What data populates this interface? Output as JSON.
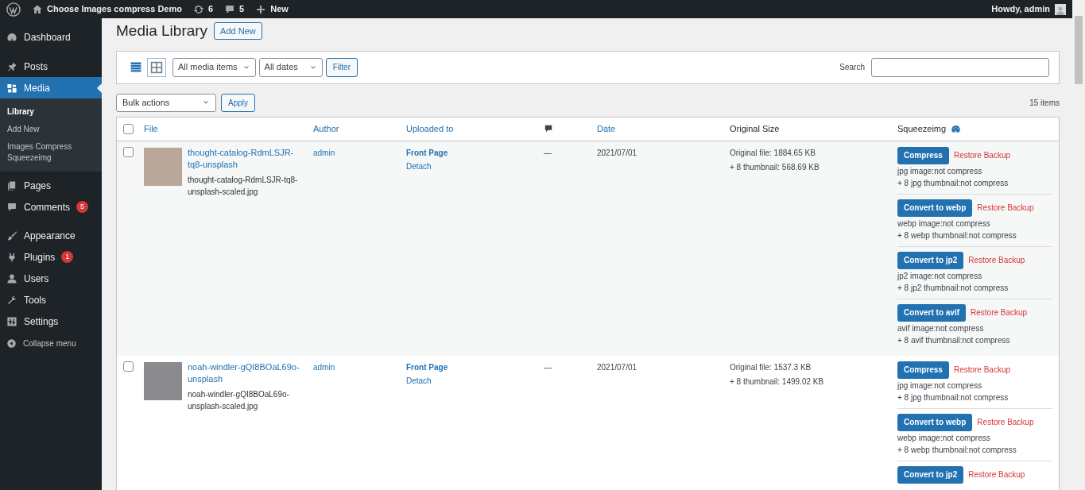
{
  "admin_bar": {
    "site_name": "Choose Images compress Demo",
    "updates": "6",
    "comments": "5",
    "new": "New",
    "greeting": "Howdy, admin"
  },
  "sidebar": {
    "items": [
      {
        "label": "Dashboard",
        "selected": false
      },
      {
        "label": "Posts",
        "selected": false
      },
      {
        "label": "Media",
        "selected": true,
        "children": [
          {
            "label": "Library",
            "selected": true
          },
          {
            "label": "Add New",
            "selected": false
          },
          {
            "label": "Images Compress Squeezeimg",
            "selected": false
          }
        ]
      },
      {
        "label": "Pages",
        "selected": false
      },
      {
        "label": "Comments",
        "selected": false,
        "badge": "5"
      },
      {
        "label": "Appearance",
        "selected": false
      },
      {
        "label": "Plugins",
        "selected": false,
        "badge": "1"
      },
      {
        "label": "Users",
        "selected": false
      },
      {
        "label": "Tools",
        "selected": false
      },
      {
        "label": "Settings",
        "selected": false
      }
    ],
    "collapse": "Collapse menu"
  },
  "page": {
    "title": "Media Library",
    "add_new": "Add New"
  },
  "filters": {
    "views": [
      {
        "kind": "list",
        "selected": true
      },
      {
        "kind": "grid",
        "selected": false
      }
    ],
    "media_type": "All media items",
    "dates": "All dates",
    "filter_button": "Filter",
    "search_label": "Search"
  },
  "bulk": {
    "action": "Bulk actions",
    "apply": "Apply",
    "count": "15 items"
  },
  "table": {
    "select_all": {
      "checked": false
    },
    "columns": [
      {
        "label": "File",
        "sortable": true
      },
      {
        "label": "Author",
        "sortable": true
      },
      {
        "label": "Uploaded to",
        "sortable": true
      },
      {
        "kind": "comments",
        "sortable": false
      },
      {
        "label": "Date",
        "sortable": true
      },
      {
        "label": "Original Size",
        "sortable": false
      },
      {
        "label": "Squeezeimg",
        "sortable": false,
        "kind": "squeeze"
      }
    ],
    "rows": [
      {
        "checked": false,
        "title": "thought-catalog-RdmLSJR-tq8-unsplash",
        "filename": "thought-catalog-RdmLSJR-tq8-unsplash-scaled.jpg",
        "author": "admin",
        "uploaded_to": "Front Page",
        "detach": "Detach",
        "comments": "—",
        "date": "2021/07/01",
        "size": [
          "Original file: 1884.65 KB",
          "+ 8 thumbnail: 568.69 KB"
        ],
        "actions": [
          {
            "button": "Compress",
            "restore": "Restore Backup",
            "lines": [
              "jpg image:not compress",
              "+ 8 jpg thumbnail:not compress"
            ]
          },
          {
            "button": "Convert to webp",
            "restore": "Restore Backup",
            "lines": [
              "webp image:not compress",
              "+ 8 webp thumbnail:not compress"
            ]
          },
          {
            "button": "Convert to jp2",
            "restore": "Restore Backup",
            "lines": [
              "jp2 image:not compress",
              "+ 8 jp2 thumbnail:not compress"
            ]
          },
          {
            "button": "Convert to avif",
            "restore": "Restore Backup",
            "lines": [
              "avif image:not compress",
              "+ 8 avif thumbnail:not compress"
            ]
          }
        ]
      },
      {
        "checked": false,
        "title": "noah-windler-gQI8BOaL69o-unsplash",
        "filename": "noah-windler-gQI8BOaL69o-unsplash-scaled.jpg",
        "author": "admin",
        "uploaded_to": "Front Page",
        "detach": "Detach",
        "comments": "—",
        "date": "2021/07/01",
        "size": [
          "Original file: 1537.3 KB",
          "+ 8 thumbnail: 1499.02 KB"
        ],
        "actions": [
          {
            "button": "Compress",
            "restore": "Restore Backup",
            "lines": [
              "jpg image:not compress",
              "+ 8 jpg thumbnail:not compress"
            ]
          },
          {
            "button": "Convert to webp",
            "restore": "Restore Backup",
            "lines": [
              "webp image:not compress",
              "+ 8 webp thumbnail:not compress"
            ]
          },
          {
            "button": "Convert to jp2",
            "restore": "Restore Backup"
          }
        ]
      }
    ]
  }
}
